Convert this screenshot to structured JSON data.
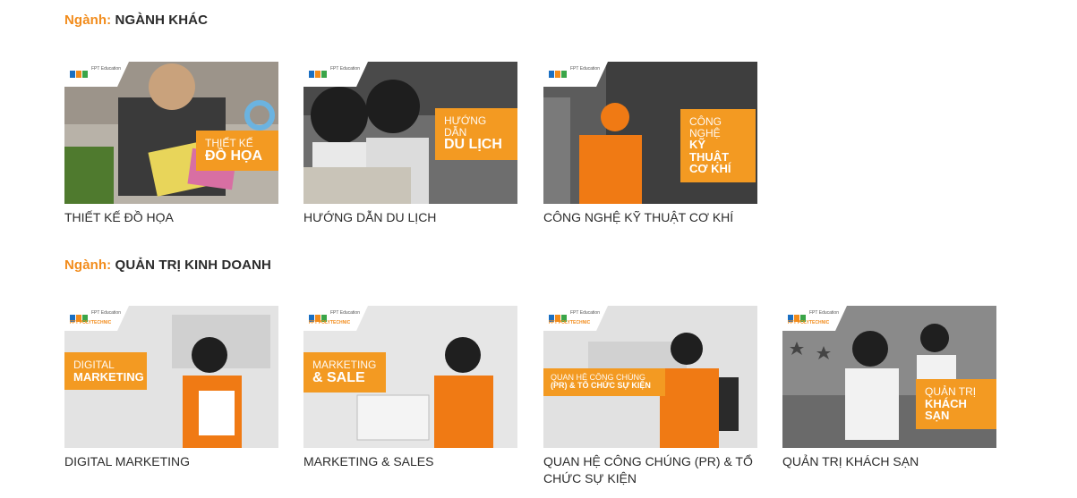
{
  "sections": [
    {
      "prefix": "Ngành:",
      "name": "NGÀNH KHÁC",
      "cards": [
        {
          "caption": "THIẾT KẾ ĐỒ HỌA",
          "badge_small": "THIẾT KẾ",
          "badge_large": "ĐỒ HỌA",
          "logo": "FPT Education",
          "logo_sub": ""
        },
        {
          "caption": "HƯỚNG DẪN DU LỊCH",
          "badge_small": "HƯỚNG DẪN",
          "badge_large": "DU LỊCH",
          "logo": "FPT Education",
          "logo_sub": ""
        },
        {
          "caption": "CÔNG NGHỆ KỸ THUẬT CƠ KHÍ",
          "badge_small": "CÔNG NGHỆ",
          "badge_large": "KỸ THUẬT CƠ KHÍ",
          "logo": "FPT Education",
          "logo_sub": ""
        }
      ]
    },
    {
      "prefix": "Ngành:",
      "name": "QUẢN TRỊ KINH DOANH",
      "cards": [
        {
          "caption": "DIGITAL MARKETING",
          "badge_small": "DIGITAL",
          "badge_large": "MARKETING",
          "logo": "FPT Education",
          "logo_sub": "FPT POLYTECHNIC"
        },
        {
          "caption": "MARKETING & SALES",
          "badge_small": "MARKETING",
          "badge_large": "& SALE",
          "logo": "FPT Education",
          "logo_sub": "FPT POLYTECHNIC"
        },
        {
          "caption": "QUAN HỆ CÔNG CHÚNG (PR) & TỔ CHỨC SỰ KIỆN",
          "badge_small": "QUAN HỆ CÔNG CHÚNG",
          "badge_large": "(PR) & TỔ CHỨC SỰ KIỆN",
          "logo": "FPT Education",
          "logo_sub": "FPT POLYTECHNIC"
        },
        {
          "caption": "QUẢN TRỊ KHÁCH SẠN",
          "badge_small": "QUẢN TRỊ",
          "badge_large": "KHÁCH SẠN",
          "logo": "FPT Education",
          "logo_sub": "FPT POLYTECHNIC"
        }
      ]
    }
  ],
  "colors": {
    "accent": "#f28c1c",
    "badge": "#f39a22",
    "text": "#2b2b2b"
  }
}
